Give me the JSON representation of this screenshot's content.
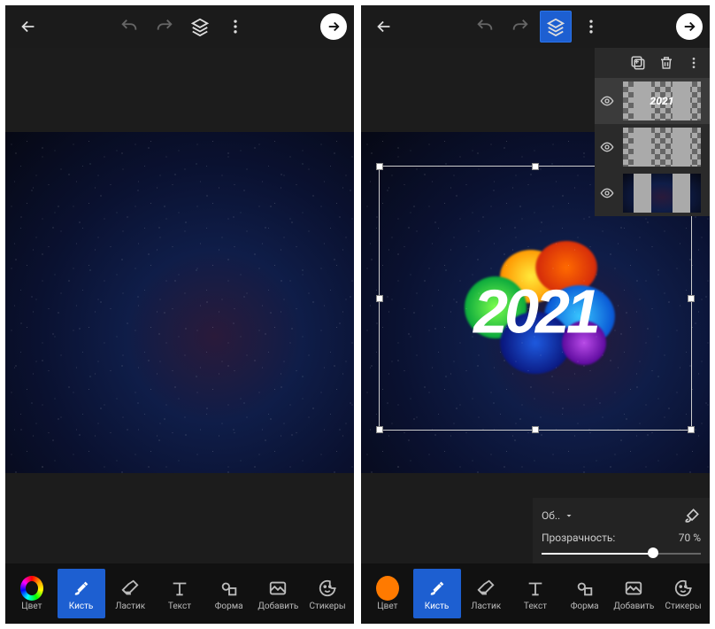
{
  "toolbar": {
    "color_label": "Цвет",
    "brush_label": "Кисть",
    "eraser_label": "Ластик",
    "text_label": "Текст",
    "shape_label": "Форма",
    "add_label": "Добавить",
    "stickers_label": "Стикеры"
  },
  "right": {
    "color_hex": "#ff7a00",
    "layer_text": "2021",
    "canvas_text": "2021",
    "blend_label": "Об..",
    "opacity_label": "Прозрачность:",
    "opacity_value": "70 %",
    "opacity_percent": 70
  }
}
